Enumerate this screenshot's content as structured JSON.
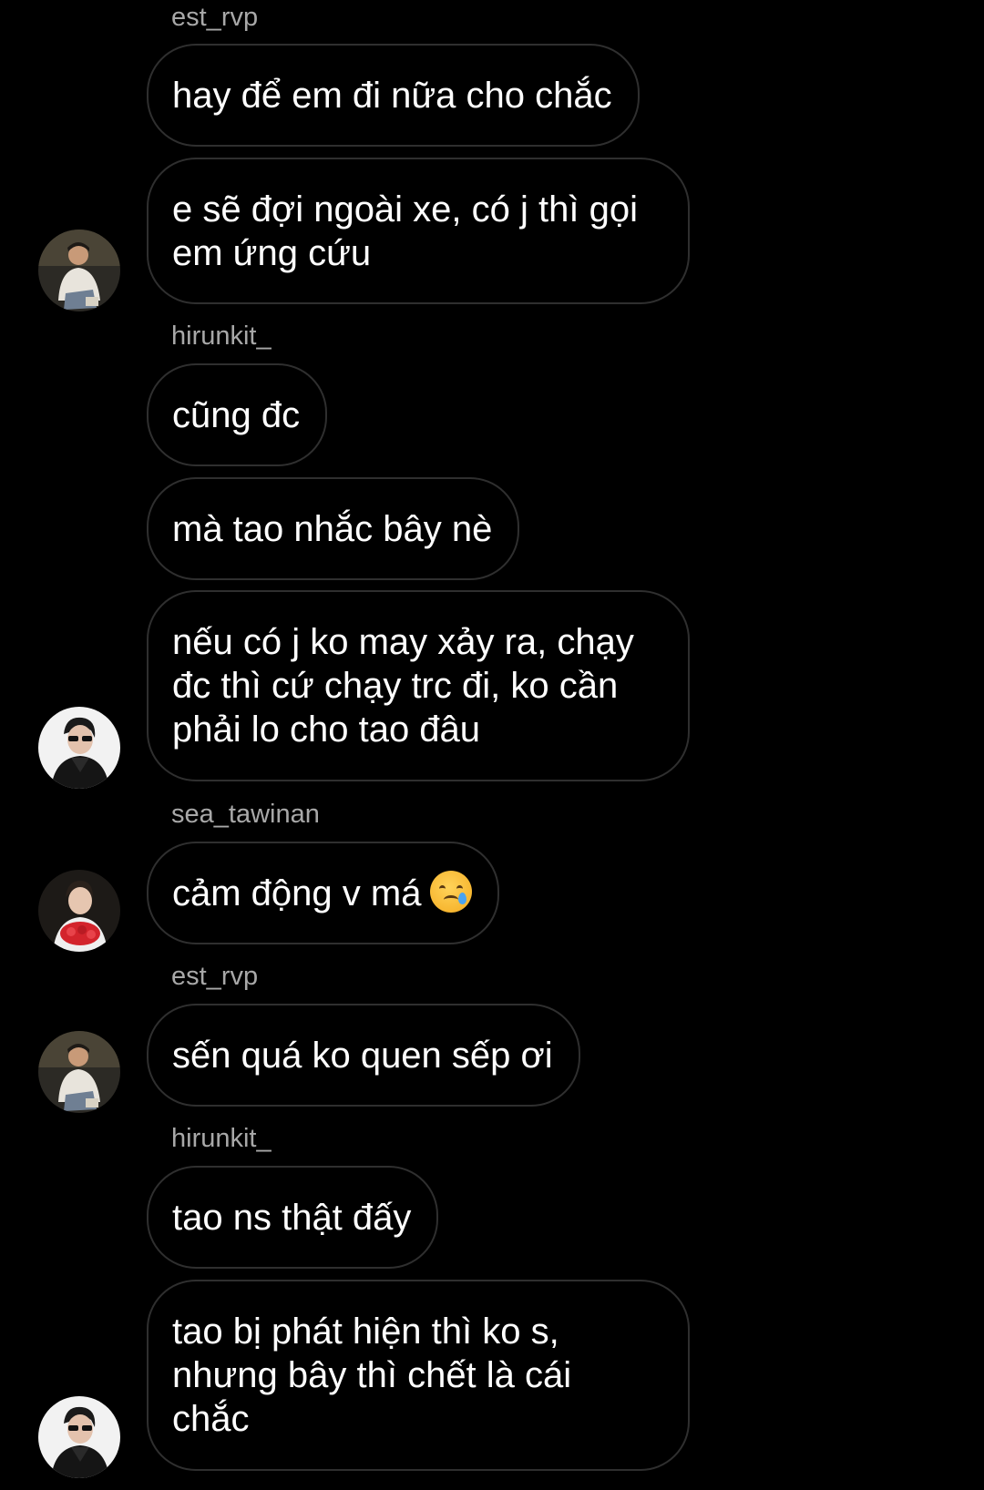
{
  "conversation": {
    "rows": [
      {
        "type": "username",
        "text": "est_rvp"
      },
      {
        "type": "message",
        "text": "hay để em đi nữa cho chắc"
      },
      {
        "type": "message",
        "text": "e sẽ đợi ngoài xe, có j thì gọi\nem ứng cứu"
      },
      {
        "type": "username",
        "text": "hirunkit_"
      },
      {
        "type": "message",
        "text": "cũng đc"
      },
      {
        "type": "message",
        "text": "mà tao nhắc bây nè"
      },
      {
        "type": "message",
        "text": "nếu có j ko may xảy ra, chạy\nđc thì cứ chạy trc đi, ko cần\nphải lo cho tao đâu"
      },
      {
        "type": "username",
        "text": "sea_tawinan"
      },
      {
        "type": "message",
        "text": "cảm động v má",
        "emoji": "crying-face-emoji"
      },
      {
        "type": "username",
        "text": "est_rvp"
      },
      {
        "type": "message",
        "text": "sến quá ko quen sếp ơi"
      },
      {
        "type": "username",
        "text": "hirunkit_"
      },
      {
        "type": "message",
        "text": "tao ns thật đấy"
      },
      {
        "type": "message",
        "text": "tao bị phát hiện thì ko s,\nnhưng bây thì chết là cái\nchắc"
      }
    ],
    "avatars": [
      {
        "user": "est_rvp",
        "icon": "avatar-est-rvp"
      },
      {
        "user": "hirunkit_",
        "icon": "avatar-hirunkit"
      },
      {
        "user": "sea_tawinan",
        "icon": "avatar-sea-tawinan"
      },
      {
        "user": "est_rvp",
        "icon": "avatar-est-rvp"
      },
      {
        "user": "hirunkit_",
        "icon": "avatar-hirunkit"
      }
    ]
  },
  "colors": {
    "background": "#000000",
    "bubble_border": "#2f2f2f",
    "message_text": "#ffffff",
    "username_text": "#a8a8a8"
  }
}
